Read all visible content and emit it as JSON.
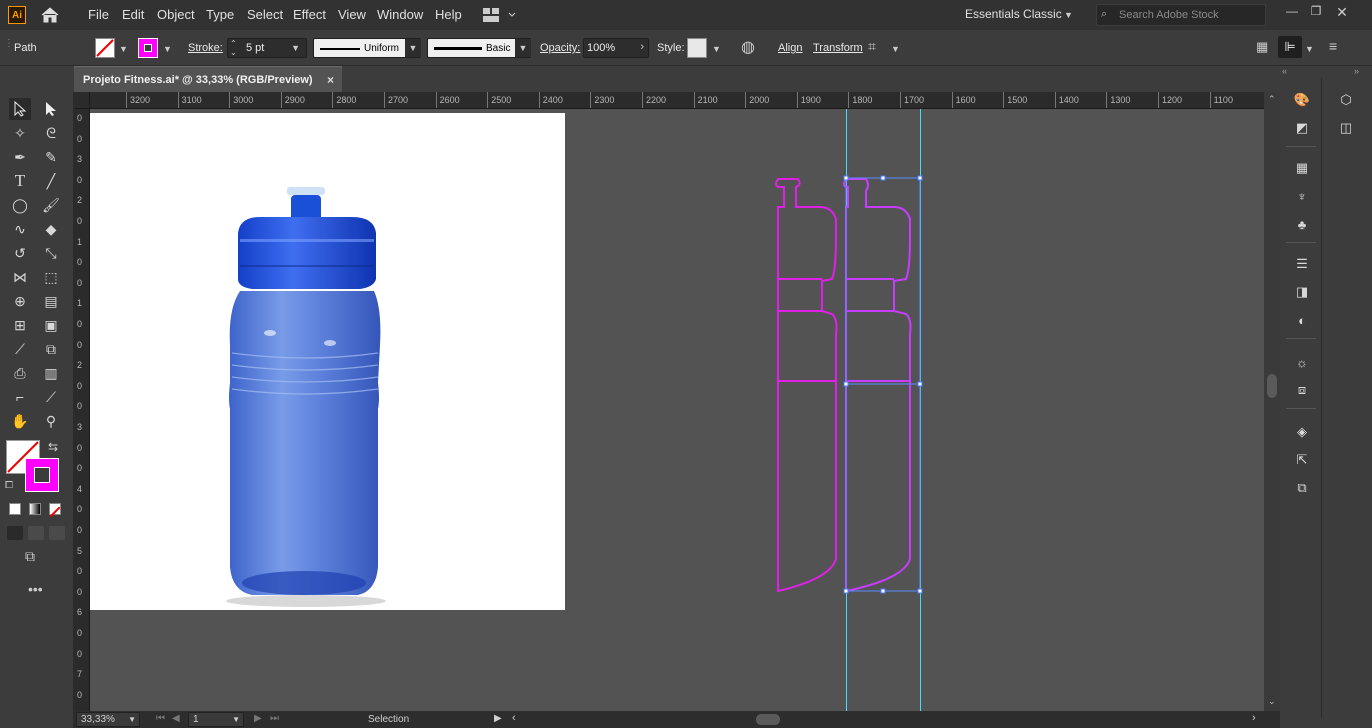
{
  "menubar": {
    "logo": "Ai",
    "items": [
      "File",
      "Edit",
      "Object",
      "Type",
      "Select",
      "Effect",
      "View",
      "Window",
      "Help"
    ],
    "workspace": "Essentials Classic",
    "search_placeholder": "Search Adobe Stock"
  },
  "control": {
    "selection_type": "Path",
    "stroke_label": "Stroke:",
    "stroke_value": "5 pt",
    "profile_uniform": "Uniform",
    "brush_basic": "Basic",
    "opacity_label": "Opacity:",
    "opacity_value": "100%",
    "style_label": "Style:",
    "align_label": "Align",
    "transform_label": "Transform",
    "stroke_color": "#ff00ff"
  },
  "document": {
    "tab_title": "Projeto Fitness.ai* @ 33,33% (RGB/Preview)",
    "close": "×"
  },
  "rulers": {
    "h_ticks": [
      "3200",
      "3100",
      "3000",
      "2900",
      "2800",
      "2700",
      "2600",
      "2500",
      "2400",
      "2300",
      "2200",
      "2100",
      "2000",
      "1900",
      "1800",
      "1700",
      "1600",
      "1500",
      "1400",
      "1300",
      "1200",
      "1100"
    ],
    "v_ticks": [
      "0",
      "0",
      "3",
      "0",
      "2",
      "0",
      "1",
      "0",
      "0",
      "1",
      "0",
      "0",
      "2",
      "0",
      "0",
      "3",
      "0",
      "0",
      "4",
      "0",
      "0",
      "5",
      "0",
      "0",
      "6",
      "0",
      "0",
      "7",
      "0"
    ]
  },
  "status": {
    "zoom": "33,33%",
    "artboard_num": "1",
    "tool_name": "Selection"
  },
  "colors": {
    "accent_guide": "#3fe0ff",
    "path_magenta": "#e020e8",
    "bottle_blue": "#3a67d6"
  }
}
